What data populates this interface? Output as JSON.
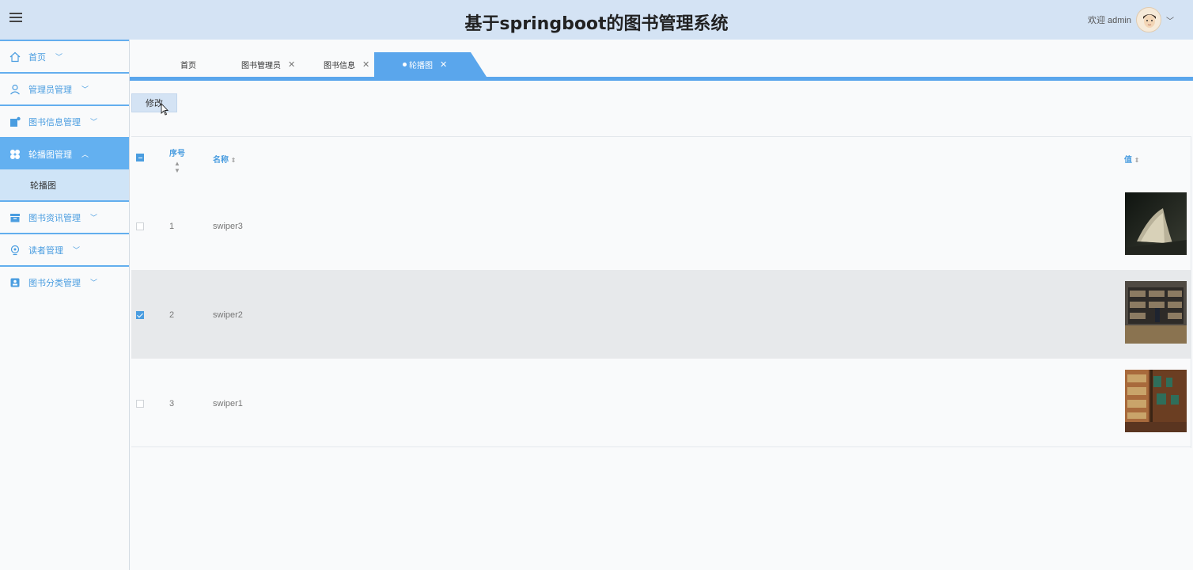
{
  "header": {
    "title": "基于springboot的图书管理系统",
    "welcome": "欢迎 admin"
  },
  "sidebar": {
    "items": [
      {
        "label": "首页",
        "icon": "home-icon"
      },
      {
        "label": "管理员管理",
        "icon": "user-icon"
      },
      {
        "label": "图书信息管理",
        "icon": "book-info-icon"
      },
      {
        "label": "轮播图管理",
        "icon": "carousel-icon",
        "active": true,
        "sub": "轮播图"
      },
      {
        "label": "图书资讯管理",
        "icon": "news-icon"
      },
      {
        "label": "读者管理",
        "icon": "reader-icon"
      },
      {
        "label": "图书分类管理",
        "icon": "category-icon"
      }
    ]
  },
  "tabs": [
    {
      "label": "首页"
    },
    {
      "label": "图书管理员"
    },
    {
      "label": "图书信息"
    },
    {
      "label": "轮播图",
      "active": true
    }
  ],
  "toolbar": {
    "edit_label": "修改"
  },
  "table": {
    "columns": {
      "index": "序号",
      "name": "名称",
      "value": "值"
    },
    "rows": [
      {
        "index": "1",
        "name": "swiper3",
        "checked": false
      },
      {
        "index": "2",
        "name": "swiper2",
        "checked": true
      },
      {
        "index": "3",
        "name": "swiper1",
        "checked": false
      }
    ]
  },
  "colors": {
    "accent": "#5aa6ec",
    "header_bg": "#d4e3f4",
    "sidebar_active": "#63b0f0"
  }
}
